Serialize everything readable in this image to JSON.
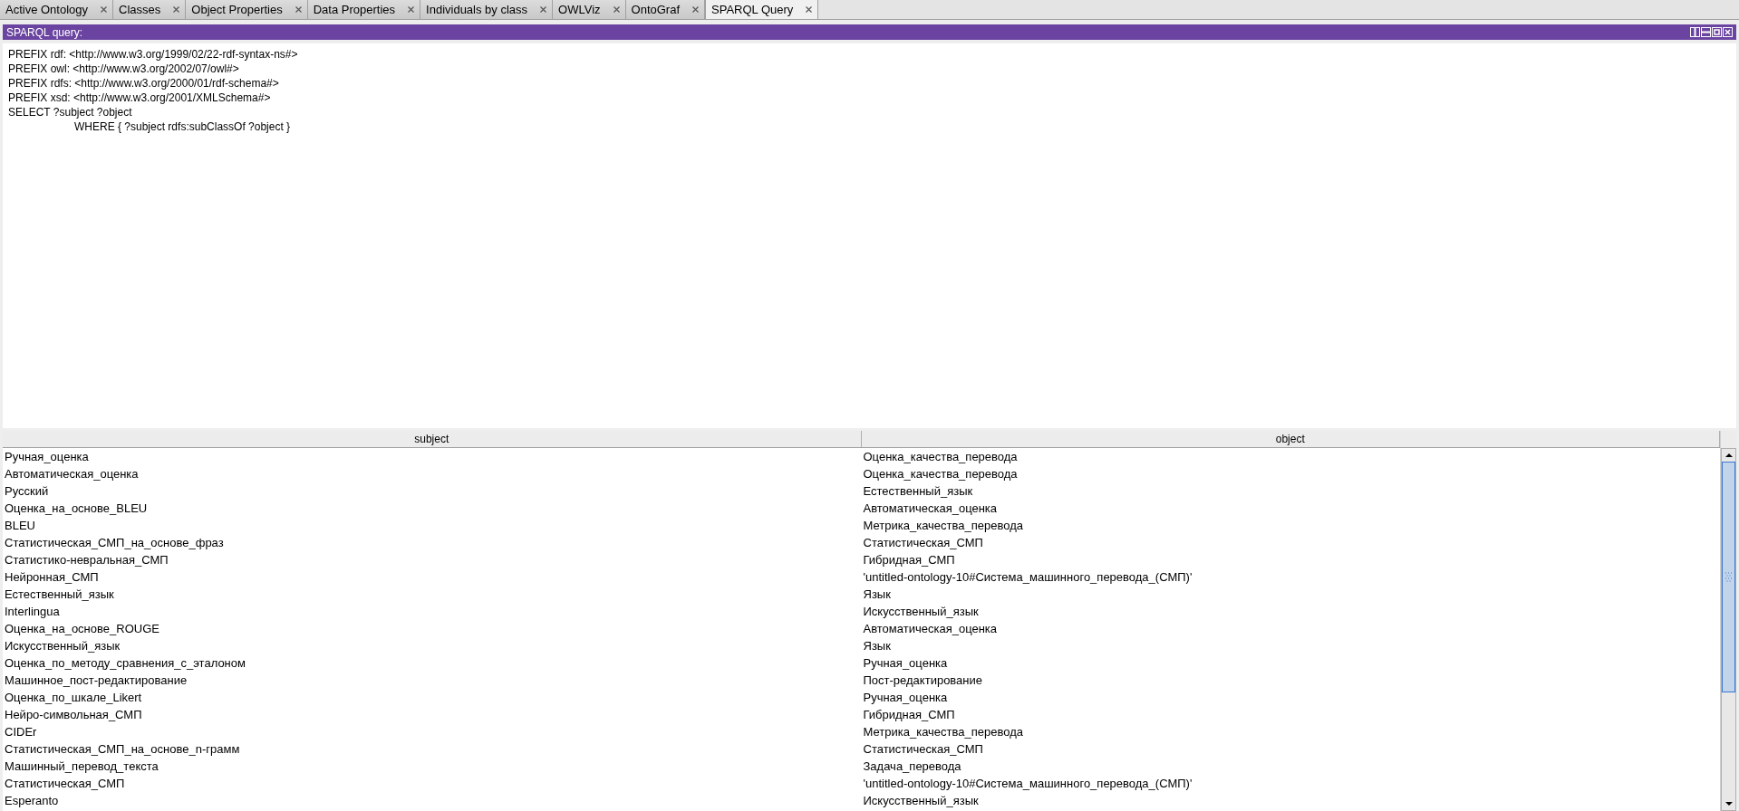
{
  "tabs": [
    {
      "label": "Active Ontology",
      "selected": false
    },
    {
      "label": "Classes",
      "selected": false
    },
    {
      "label": "Object Properties",
      "selected": false
    },
    {
      "label": "Data Properties",
      "selected": false
    },
    {
      "label": "Individuals by class",
      "selected": false
    },
    {
      "label": "OWLViz",
      "selected": false
    },
    {
      "label": "OntoGraf",
      "selected": false
    },
    {
      "label": "SPARQL Query",
      "selected": true
    }
  ],
  "panel": {
    "title": "SPARQL query:"
  },
  "query": [
    "PREFIX rdf: <http://www.w3.org/1999/02/22-rdf-syntax-ns#>",
    "PREFIX owl: <http://www.w3.org/2002/07/owl#>",
    "PREFIX rdfs: <http://www.w3.org/2000/01/rdf-schema#>",
    "PREFIX xsd: <http://www.w3.org/2001/XMLSchema#>",
    "SELECT ?subject ?object",
    "\tWHERE { ?subject rdfs:subClassOf ?object }"
  ],
  "table": {
    "columns": [
      "subject",
      "object"
    ],
    "rows": [
      [
        "Ручная_оценка",
        "Оценка_качества_перевода"
      ],
      [
        "Автоматическая_оценка",
        "Оценка_качества_перевода"
      ],
      [
        "Русский",
        "Естественный_язык"
      ],
      [
        "Оценка_на_основе_BLEU",
        "Автоматическая_оценка"
      ],
      [
        "BLEU",
        "Метрика_качества_перевода"
      ],
      [
        "Статистическая_СМП_на_основе_фраз",
        "Статистическая_СМП"
      ],
      [
        "Статистико-невральная_СМП",
        "Гибридная_СМП"
      ],
      [
        "Нейронная_СМП",
        "'untitled-ontology-10#Система_машинного_перевода_(СМП)'"
      ],
      [
        "Естественный_язык",
        "Язык"
      ],
      [
        "Interlingua",
        "Искусственный_язык"
      ],
      [
        "Оценка_на_основе_ROUGE",
        "Автоматическая_оценка"
      ],
      [
        "Искусственный_язык",
        "Язык"
      ],
      [
        "Оценка_по_методу_сравнения_с_эталоном",
        "Ручная_оценка"
      ],
      [
        "Машинное_пост-редактирование",
        "Пост-редактирование"
      ],
      [
        "Оценка_по_шкале_Likert",
        "Ручная_оценка"
      ],
      [
        "Нейро-символьная_СМП",
        "Гибридная_СМП"
      ],
      [
        "CIDEr",
        "Метрика_качества_перевода"
      ],
      [
        "Статистическая_СМП_на_основе_n-грамм",
        "Статистическая_СМП"
      ],
      [
        "Машинный_перевод_текста",
        "Задача_перевода"
      ],
      [
        "Статистическая_СМП",
        "'untitled-ontology-10#Система_машинного_перевода_(СМП)'"
      ],
      [
        "Esperanto",
        "Искусственный_язык"
      ]
    ]
  }
}
